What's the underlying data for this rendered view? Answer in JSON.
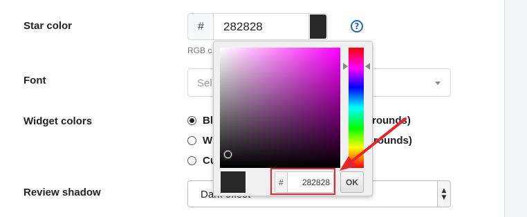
{
  "form": {
    "star_color": {
      "label": "Star color",
      "hash_symbol": "#",
      "value": "282828",
      "swatch_color": "#282828",
      "hint": "RGB c",
      "help_glyph": "?"
    },
    "font": {
      "label": "Font",
      "placeholder": "Sel"
    },
    "widget_colors": {
      "label": "Widget colors",
      "options": [
        {
          "label_start": "Bl",
          "label_end": "rounds)",
          "selected": true
        },
        {
          "label_start": "W",
          "label_end": "rounds)",
          "selected": false
        },
        {
          "label_start": "Cu",
          "label_end": "",
          "selected": false
        }
      ]
    },
    "review_shadow": {
      "label": "Review shadow",
      "value": "Dark offset"
    }
  },
  "color_picker": {
    "hue_color": "#ff00ff",
    "preview_color": "#282828",
    "hash_symbol": "#",
    "hex_value": "282828",
    "ok_label": "OK"
  },
  "annotation": {
    "color": "#e8242b"
  },
  "icons": {
    "help": "question-circle-icon",
    "select_caret": "caret-down-icon",
    "select_spinner": "up-down-arrows-icon"
  }
}
